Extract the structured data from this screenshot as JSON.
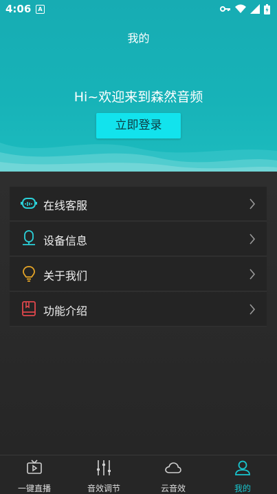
{
  "status_bar": {
    "time": "4:06",
    "notification_letter": "A"
  },
  "header": {
    "title": "我的",
    "greeting": "Hi~欢迎来到森然音频",
    "login_button": "立即登录"
  },
  "menu": [
    {
      "label": "在线客服",
      "icon": "robot-icon",
      "color": "#2bd0d8"
    },
    {
      "label": "设备信息",
      "icon": "microphone-icon",
      "color": "#2bd0d8"
    },
    {
      "label": "关于我们",
      "icon": "lightbulb-icon",
      "color": "#e6a527"
    },
    {
      "label": "功能介绍",
      "icon": "book-icon",
      "color": "#e0474c"
    }
  ],
  "tabs": [
    {
      "label": "一键直播",
      "icon": "tv-play-icon",
      "active": false
    },
    {
      "label": "音效调节",
      "icon": "sliders-icon",
      "active": false
    },
    {
      "label": "云音效",
      "icon": "cloud-icon",
      "active": false
    },
    {
      "label": "我的",
      "icon": "person-icon",
      "active": true
    }
  ],
  "colors": {
    "accent": "#18c6cf",
    "header_bg": "#17b0b6",
    "button_bg": "#12e3ed"
  }
}
